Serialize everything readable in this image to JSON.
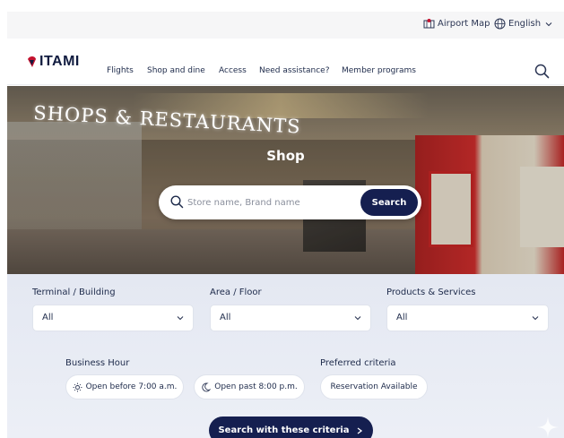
{
  "utility": {
    "airport_map": "Airport Map",
    "language": "English"
  },
  "brand": {
    "logo_text": "ITAMI"
  },
  "nav": {
    "items": [
      {
        "label": "Flights"
      },
      {
        "label": "Shop and dine"
      },
      {
        "label": "Access"
      },
      {
        "label": "Need assistance?"
      },
      {
        "label": "Member programs"
      }
    ]
  },
  "hero": {
    "sign_text": "SHOPS & RESTAURANTS",
    "title": "Shop",
    "search_placeholder": "Store name, Brand name",
    "search_button": "Search"
  },
  "filters": {
    "terminal_label": "Terminal / Building",
    "terminal_value": "All",
    "area_label": "Area / Floor",
    "area_value": "All",
    "products_label": "Products & Services",
    "products_value": "All",
    "business_hour_label": "Business Hour",
    "open_before": "Open before 7:00 a.m.",
    "open_past": "Open past 8:00 p.m.",
    "preferred_label": "Preferred criteria",
    "reservation": "Reservation Available",
    "submit": "Search with these criteria"
  },
  "colors": {
    "primary_navy": "#151f50",
    "filter_bg": "#e4e8f2",
    "logo_accent": "#c4122f"
  },
  "icons": [
    "map-icon",
    "globe-icon",
    "chevron-down-icon",
    "search-icon",
    "sun-icon",
    "moon-icon",
    "chevron-right-icon",
    "sparkle-icon"
  ]
}
